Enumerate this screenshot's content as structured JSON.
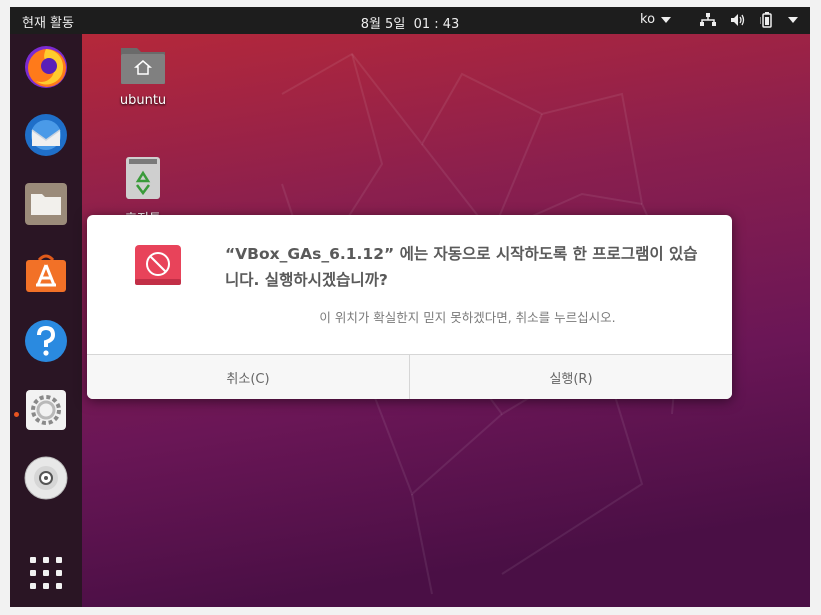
{
  "topbar": {
    "activities": "현재 활동",
    "clock_date": "8월 5일",
    "clock_time": "01 : 43",
    "language": "ko",
    "icons": [
      "network-icon",
      "volume-icon",
      "battery-icon",
      "system-menu-icon"
    ]
  },
  "dock": {
    "apps": [
      {
        "name": "firefox-icon"
      },
      {
        "name": "thunderbird-icon"
      },
      {
        "name": "files-icon"
      },
      {
        "name": "software-icon"
      },
      {
        "name": "help-icon"
      },
      {
        "name": "settings-icon",
        "running": true
      },
      {
        "name": "cd-drive-icon"
      }
    ],
    "show_apps": "show-applications-icon"
  },
  "desktop": {
    "home_label": "ubuntu",
    "trash_label": "휴지통"
  },
  "dialog": {
    "title": "“VBox_GAs_6.1.12” 에는 자동으로 시작하도록 한 프로그램이 있습니다. 실행하시겠습니까?",
    "message": "이 위치가 확실한지 믿지 못하겠다면, 취소를 누르십시오.",
    "cancel_label": "취소(C)",
    "run_label": "실행(R)",
    "icon": "prohibited-icon"
  },
  "colors": {
    "accent": "#e95420",
    "dialog_icon": "#e8435a",
    "topbar": "#1d1d1d"
  }
}
